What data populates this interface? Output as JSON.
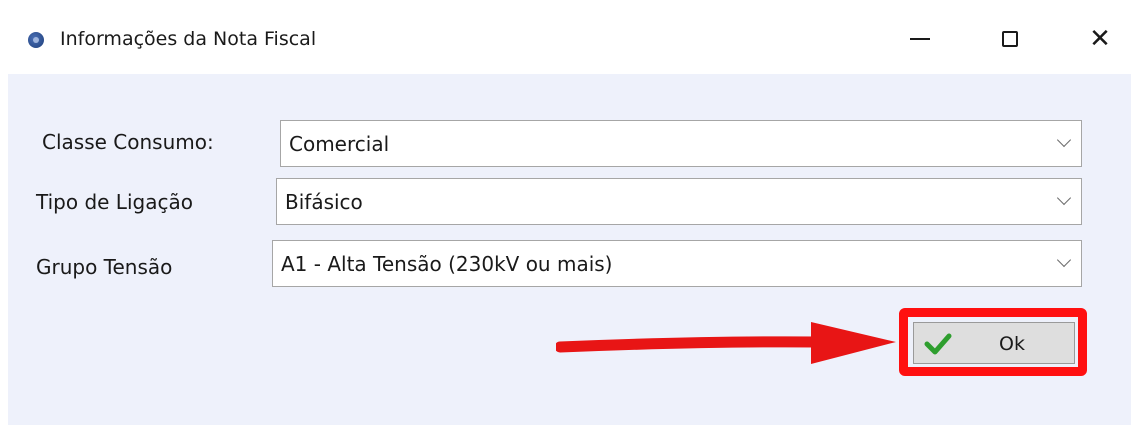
{
  "window": {
    "title": "Informações da Nota Fiscal",
    "controls": {
      "minimize": "minimize",
      "maximize": "maximize",
      "close": "close"
    }
  },
  "form": {
    "classe_consumo": {
      "label": "Classe Consumo:",
      "value": "Comercial"
    },
    "tipo_ligacao": {
      "label": "Tipo de Ligação",
      "value": "Bifásico"
    },
    "grupo_tensao": {
      "label": "Grupo Tensão",
      "value": "A1 - Alta Tensão (230kV ou mais)"
    }
  },
  "actions": {
    "ok_label": "Ok",
    "ok_icon": "checkmark-icon"
  },
  "annotation": {
    "arrow_color": "#e81515",
    "highlight_color": "#ff1010"
  },
  "colors": {
    "window_bg": "#eef1fb",
    "check_green": "#2e9e2e"
  }
}
